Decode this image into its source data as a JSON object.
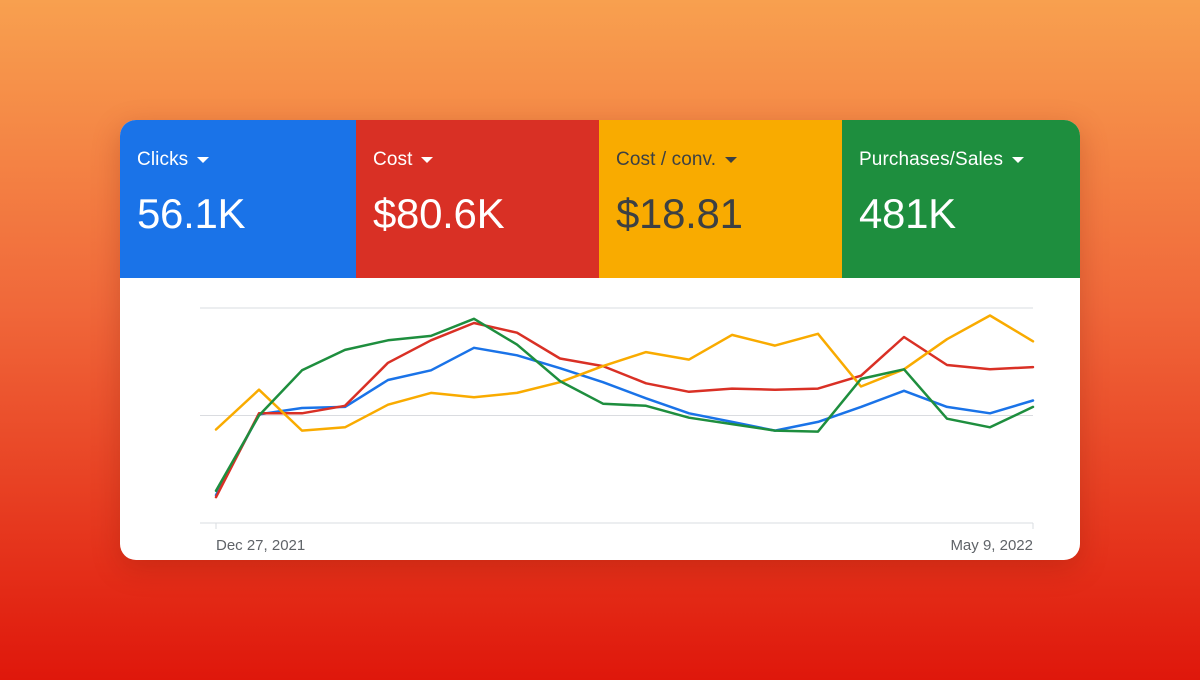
{
  "colors": {
    "clicks": "#1a73e8",
    "cost": "#d93025",
    "cost_per_conv": "#f9ab00",
    "purchases": "#1e8e3e",
    "tile_text_light": "#ffffff",
    "tile_text_dark": "#3c4043",
    "gridline": "#dadce0",
    "axis_label": "#5f6368"
  },
  "metrics": [
    {
      "key": "clicks",
      "label": "Clicks",
      "value": "56.1K",
      "icon": "chevron-down-icon"
    },
    {
      "key": "cost",
      "label": "Cost",
      "value": "$80.6K",
      "icon": "chevron-down-icon"
    },
    {
      "key": "cost_per_conv",
      "label": "Cost / conv.",
      "value": "$18.81",
      "icon": "chevron-down-icon"
    },
    {
      "key": "purchases",
      "label": "Purchases/Sales",
      "value": "481K",
      "icon": "chevron-down-icon"
    }
  ],
  "chart_data": {
    "type": "line",
    "x": [
      "2021-12-27",
      "2022-01-03",
      "2022-01-10",
      "2022-01-17",
      "2022-01-24",
      "2022-01-31",
      "2022-02-07",
      "2022-02-14",
      "2022-02-21",
      "2022-02-28",
      "2022-03-07",
      "2022-03-14",
      "2022-03-21",
      "2022-03-28",
      "2022-04-04",
      "2022-04-11",
      "2022-04-18",
      "2022-04-25",
      "2022-05-02",
      "2022-05-09"
    ],
    "x_tick_labels": [
      "Dec 27, 2021",
      "May 9, 2022"
    ],
    "ylim": [
      0,
      2
    ],
    "gridlines": [
      0,
      1,
      2
    ],
    "legend": "none",
    "series": [
      {
        "color_key": "clicks",
        "values": [
          0.26,
          1.01,
          1.07,
          1.08,
          1.33,
          1.42,
          1.63,
          1.56,
          1.44,
          1.31,
          1.16,
          1.02,
          0.94,
          0.86,
          0.94,
          1.08,
          1.23,
          1.08,
          1.02,
          1.14
        ]
      },
      {
        "color_key": "cost",
        "values": [
          0.24,
          1.02,
          1.02,
          1.09,
          1.49,
          1.7,
          1.86,
          1.77,
          1.53,
          1.46,
          1.3,
          1.22,
          1.25,
          1.24,
          1.25,
          1.37,
          1.73,
          1.47,
          1.43,
          1.45
        ]
      },
      {
        "color_key": "cost_per_conv",
        "values": [
          0.87,
          1.24,
          0.86,
          0.89,
          1.1,
          1.21,
          1.17,
          1.21,
          1.31,
          1.46,
          1.59,
          1.52,
          1.75,
          1.65,
          1.76,
          1.27,
          1.43,
          1.71,
          1.93,
          1.69
        ]
      },
      {
        "color_key": "purchases",
        "values": [
          0.3,
          1.0,
          1.42,
          1.61,
          1.7,
          1.74,
          1.9,
          1.66,
          1.32,
          1.11,
          1.09,
          0.98,
          0.92,
          0.86,
          0.85,
          1.34,
          1.43,
          0.97,
          0.89,
          1.08
        ]
      }
    ]
  }
}
